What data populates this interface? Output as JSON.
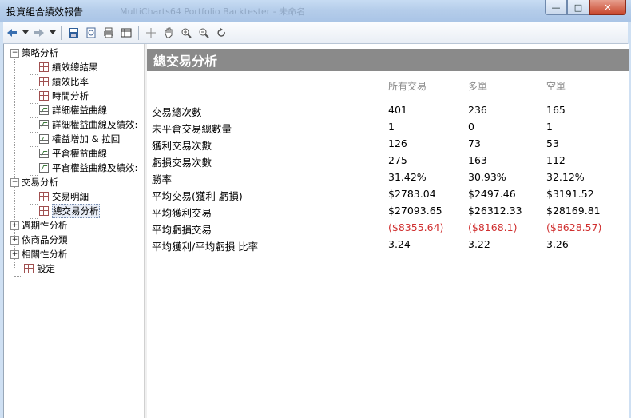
{
  "window": {
    "title": "投資組合績效報告",
    "background_title": "MultiCharts64 Portfolio Backtester - 未命名",
    "controls": {
      "minimize": "—",
      "maximize": "□",
      "close": "✕"
    }
  },
  "toolbar": {
    "icons": [
      "back-icon",
      "dropdown-icon",
      "forward-icon",
      "dropdown-icon",
      "save-icon",
      "print-preview-icon",
      "print-icon",
      "table-icon",
      "crosshair-icon",
      "hand-icon",
      "zoom-in-icon",
      "zoom-out-icon",
      "refresh-icon"
    ]
  },
  "tree": {
    "items": [
      {
        "label": "策略分析",
        "expander": "−"
      },
      {
        "label": "績效總結果"
      },
      {
        "label": "績效比率"
      },
      {
        "label": "時間分析"
      },
      {
        "label": "詳細權益曲線"
      },
      {
        "label": "詳細權益曲線及績效:"
      },
      {
        "label": "權益增加 & 拉回"
      },
      {
        "label": "平倉權益曲線"
      },
      {
        "label": "平倉權益曲線及績效:"
      },
      {
        "label": "交易分析",
        "expander": "−"
      },
      {
        "label": "交易明細"
      },
      {
        "label": "總交易分析"
      },
      {
        "label": "週期性分析",
        "expander": "+"
      },
      {
        "label": "依商品分類",
        "expander": "+"
      },
      {
        "label": "相關性分析",
        "expander": "+"
      },
      {
        "label": "設定"
      }
    ]
  },
  "report": {
    "title": "總交易分析",
    "columns": [
      "所有交易",
      "多單",
      "空單"
    ],
    "rows": [
      {
        "label": "交易總次數",
        "all": "401",
        "long": "236",
        "short": "165"
      },
      {
        "label": "未平倉交易總數量",
        "all": "1",
        "long": "0",
        "short": "1"
      },
      {
        "label": "獲利交易次數",
        "all": "126",
        "long": "73",
        "short": "53"
      },
      {
        "label": "虧損交易次數",
        "all": "275",
        "long": "163",
        "short": "112"
      },
      {
        "label": "勝率",
        "all": "31.42%",
        "long": "30.93%",
        "short": "32.12%"
      },
      {
        "label": "平均交易(獲利 虧損)",
        "all": "$2783.04",
        "long": "$2497.46",
        "short": "$3191.52"
      },
      {
        "label": "平均獲利交易",
        "all": "$27093.65",
        "long": "$26312.33",
        "short": "$28169.81"
      },
      {
        "label": "平均虧損交易",
        "all": "($8355.64)",
        "long": "($8168.1)",
        "short": "($8628.57)"
      },
      {
        "label": "平均獲利/平均虧損 比率",
        "all": "3.24",
        "long": "3.22",
        "short": "3.26"
      }
    ]
  },
  "colors": {
    "negative": "#d03030",
    "header_bg": "#8a8a8a",
    "column_head": "#8a8a8a"
  }
}
